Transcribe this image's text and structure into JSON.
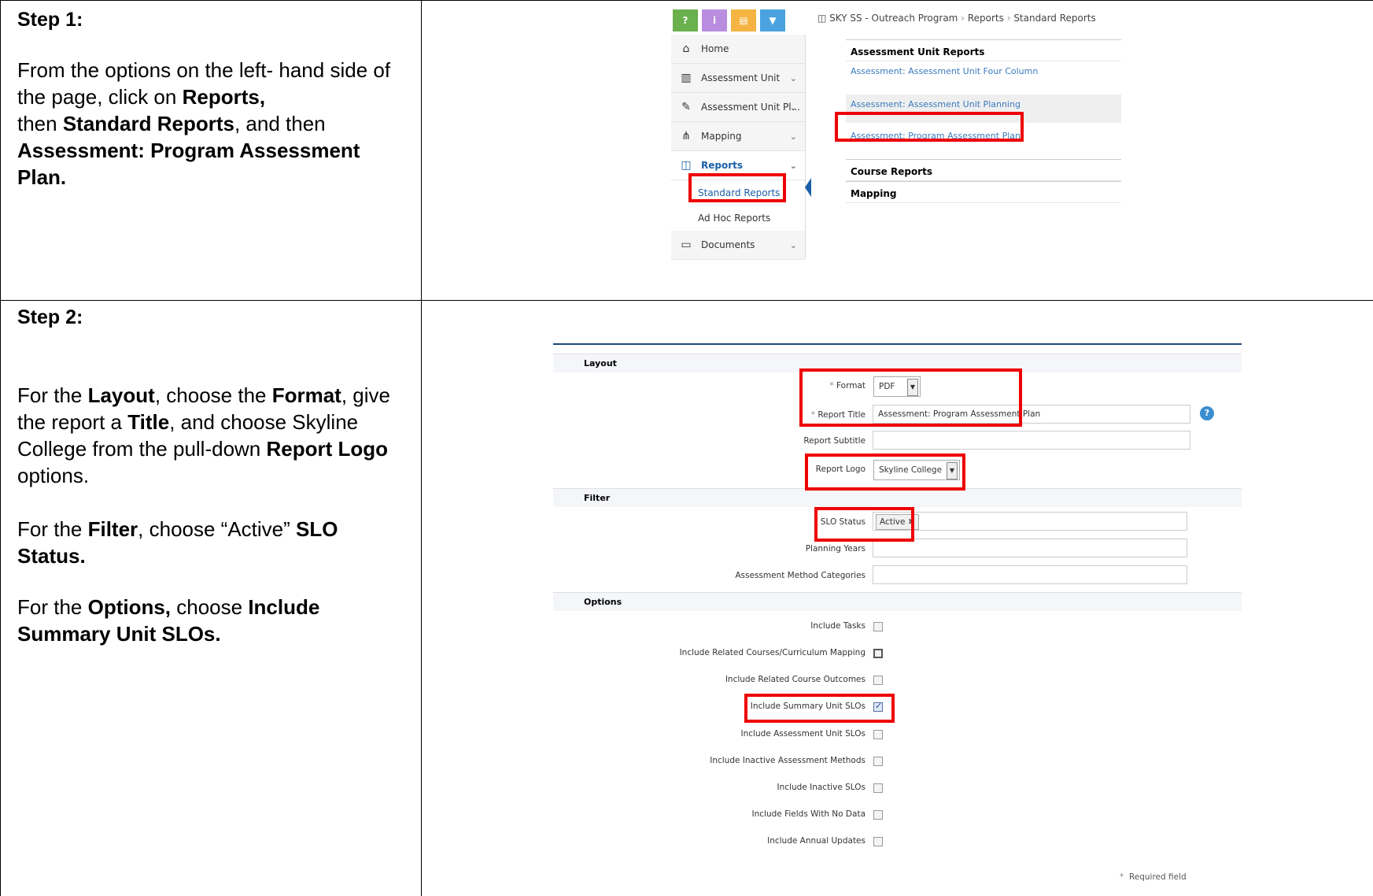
{
  "step1": {
    "title": "Step 1:",
    "instr": {
      "p1": "From the options on the left- hand side of the page, click on ",
      "b1": "Reports,",
      "p2": " then ",
      "b2": "Standard Reports",
      "p3": ", and then ",
      "b3": "Assessment: Program Assessment Plan."
    },
    "screenshot": {
      "top_buttons": [
        "?",
        "i",
        "▤",
        "▼"
      ],
      "breadcrumb": [
        "SKY SS - Outreach Program",
        "Reports",
        "Standard Reports"
      ],
      "sidebar": [
        {
          "label": "Home",
          "icon": "home-icon"
        },
        {
          "label": "Assessment Unit",
          "icon": "institution-icon"
        },
        {
          "label": "Assessment Unit Pl...",
          "icon": "pencil-icon"
        },
        {
          "label": "Mapping",
          "icon": "sitemap-icon"
        },
        {
          "label": "Reports",
          "icon": "columns-icon"
        },
        {
          "label": "Standard Reports"
        },
        {
          "label": "Ad Hoc Reports"
        },
        {
          "label": "Documents",
          "icon": "folder-icon"
        }
      ],
      "report_heads": [
        "Assessment Unit Reports",
        "Course Reports",
        "Mapping"
      ],
      "report_links": [
        "Assessment: Assessment Unit Four Column",
        "Assessment: Assessment Unit Planning",
        "Assessment: Program Assessment Plan"
      ]
    }
  },
  "step2": {
    "title": "Step 2:",
    "instr": {
      "a1": "For the ",
      "a2": "Layout",
      "a3": ", choose the ",
      "a4": "Format",
      "a5": ", give the report a ",
      "a6": "Title",
      "a7": ", and choose Skyline College from the pull-down ",
      "a8": "Report Logo",
      "a9": " options.",
      "b1": "For the ",
      "b2": "Filter",
      "b3": ", choose “Active” ",
      "b4": "SLO Status.",
      "c1": "For the ",
      "c2": "Options,",
      "c3": " choose ",
      "c4": "Include Summary Unit SLOs."
    },
    "screenshot": {
      "sections": [
        "Layout",
        "Filter",
        "Options"
      ],
      "format_label": "Format",
      "format_value": "PDF",
      "title_label": "Report Title",
      "title_value": "Assessment: Program Assessment Plan",
      "subtitle_label": "Report Subtitle",
      "logo_label": "Report Logo",
      "logo_value": "Skyline College",
      "slo_label": "SLO Status",
      "slo_tag": "Active",
      "planning_label": "Planning Years",
      "method_label": "Assessment Method Categories",
      "options": [
        {
          "label": "Include Tasks",
          "checked": false
        },
        {
          "label": "Include Related Courses/Curriculum Mapping",
          "checked": false
        },
        {
          "label": "Include Related Course Outcomes",
          "checked": false
        },
        {
          "label": "Include Summary Unit SLOs",
          "checked": true
        },
        {
          "label": "Include Assessment Unit SLOs",
          "checked": false
        },
        {
          "label": "Include Inactive Assessment Methods",
          "checked": false
        },
        {
          "label": "Include Inactive SLOs",
          "checked": false
        },
        {
          "label": "Include Fields With No Data",
          "checked": false
        },
        {
          "label": "Include Annual Updates",
          "checked": false
        }
      ],
      "required_note": "Required field",
      "asterisk": "*"
    }
  }
}
